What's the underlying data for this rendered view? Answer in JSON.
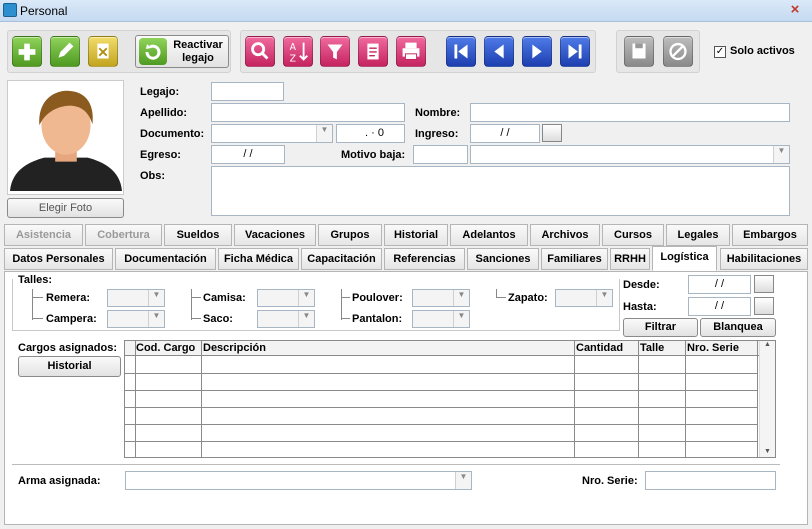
{
  "window": {
    "title": "Personal",
    "close": "×"
  },
  "toolbar": {
    "reactivar": "Reactivar legajo",
    "solo_activos": "Solo activos",
    "solo_activos_checked": "✓"
  },
  "photo": {
    "button": "Elegir Foto"
  },
  "form": {
    "legajo_label": "Legajo:",
    "legajo": "",
    "apellido_label": "Apellido:",
    "apellido": "",
    "nombre_label": "Nombre:",
    "nombre": "",
    "documento_label": "Documento:",
    "documento": "",
    "documento_num": ". · 0",
    "ingreso_label": "Ingreso:",
    "ingreso": "/ /",
    "egreso_label": "Egreso:",
    "egreso": "/ /",
    "motivo_label": "Motivo baja:",
    "motivo": "",
    "obs_label": "Obs:",
    "obs": ""
  },
  "tabs_row1": [
    "Asistencia",
    "Cobertura",
    "Sueldos",
    "Vacaciones",
    "Grupos",
    "Historial",
    "Adelantos",
    "Archivos",
    "Cursos",
    "Legales",
    "Embargos"
  ],
  "tabs_row2": [
    "Datos Personales",
    "Documentación",
    "Ficha Médica",
    "Capacitación",
    "Referencias",
    "Sanciones",
    "Familiares",
    "RRHH",
    "Logística",
    "Habilitaciones"
  ],
  "logistica": {
    "talles_label": "Talles:",
    "remera": "Remera:",
    "campera": "Campera:",
    "camisa": "Camisa:",
    "saco": "Saco:",
    "poulover": "Poulover:",
    "pantalon": "Pantalon:",
    "zapato": "Zapato:",
    "desde_label": "Desde:",
    "desde": "/ /",
    "hasta_label": "Hasta:",
    "hasta": "/ /",
    "filtrar": "Filtrar",
    "blanquea": "Blanquea",
    "cargos_label": "Cargos asignados:",
    "historial": "Historial",
    "columns": [
      "Cod. Cargo",
      "Descripción",
      "Cantidad",
      "Talle",
      "Nro. Serie"
    ],
    "arma_label": "Arma asignada:",
    "nro_serie_label": "Nro. Serie:"
  }
}
